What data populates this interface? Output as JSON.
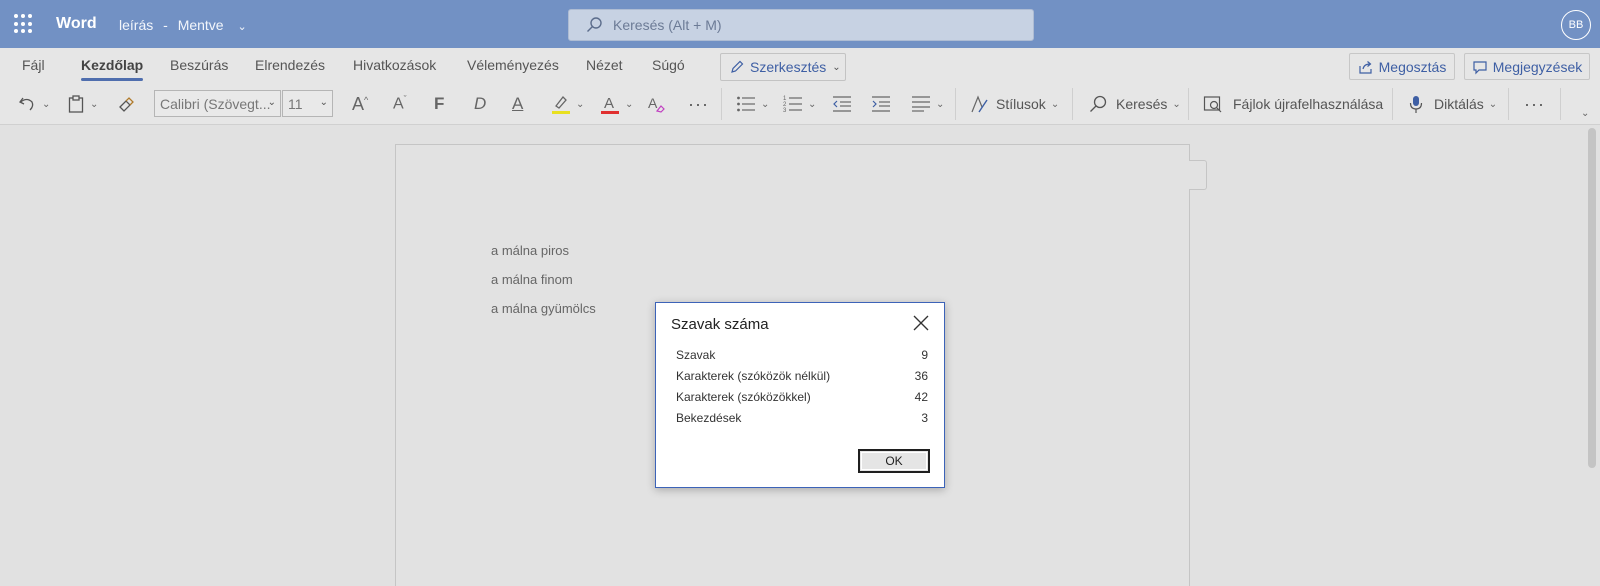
{
  "titlebar": {
    "app_name": "Word",
    "doc_title": "leírás",
    "separator": "-",
    "save_status": "Mentve",
    "search_placeholder": "Keresés (Alt + M)",
    "avatar_initials": "BB",
    "bar_color": "#7291c4"
  },
  "ribbon": {
    "tabs": [
      {
        "label": "Fájl",
        "active": false
      },
      {
        "label": "Kezdőlap",
        "active": true
      },
      {
        "label": "Beszúrás",
        "active": false
      },
      {
        "label": "Elrendezés",
        "active": false
      },
      {
        "label": "Hivatkozások",
        "active": false
      },
      {
        "label": "Véleményezés",
        "active": false
      },
      {
        "label": "Nézet",
        "active": false
      },
      {
        "label": "Súgó",
        "active": false
      }
    ],
    "edit_mode_label": "Szerkesztés",
    "share_label": "Megosztás",
    "comments_label": "Megjegyzések",
    "font_name": "Calibri (Szövegt...",
    "font_size": "11",
    "bold_glyph": "F",
    "italic_glyph": "D",
    "underline_glyph": "A",
    "styles_label": "Stílusok",
    "find_label": "Keresés",
    "reuse_files_label": "Fájlok újrafelhasználása",
    "dictate_label": "Diktálás",
    "accent_color": "#3e5fa4"
  },
  "document": {
    "paragraphs": [
      "a málna piros",
      "a málna finom",
      "a málna gyümölcs"
    ]
  },
  "dialog": {
    "title": "Szavak száma",
    "stats": [
      {
        "label": "Szavak",
        "value": "9"
      },
      {
        "label": "Karakterek (szóközök nélkül)",
        "value": "36"
      },
      {
        "label": "Karakterek (szóközökkel)",
        "value": "42"
      },
      {
        "label": "Bekezdések",
        "value": "3"
      }
    ],
    "ok_label": "OK"
  }
}
